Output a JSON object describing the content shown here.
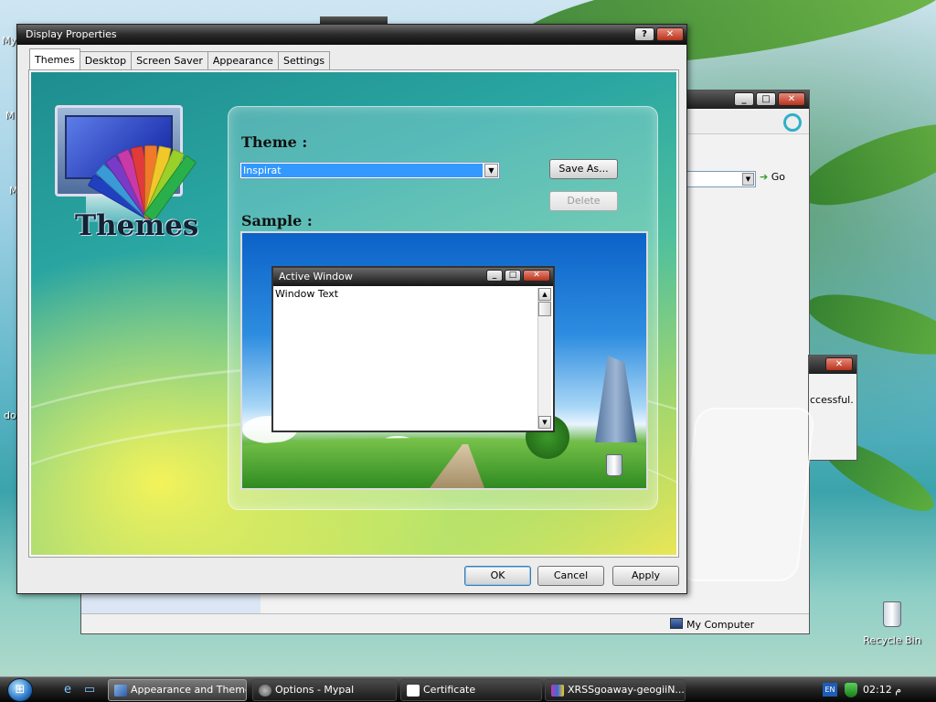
{
  "desktop": {
    "labels": [
      "My",
      "M",
      "M",
      "do"
    ],
    "recycle_bin": "Recycle Bin"
  },
  "explorer_window": {
    "go_label": "Go",
    "status_text": "My Computer"
  },
  "message_window": {
    "text": "ccessful."
  },
  "dialog": {
    "title": "Display Properties",
    "help_label": "?",
    "close_label": "✕",
    "tabs": [
      "Themes",
      "Desktop",
      "Screen Saver",
      "Appearance",
      "Settings"
    ],
    "active_tab": "Themes",
    "hero_title": "Themes",
    "theme_label": "Theme :",
    "theme_value": "Inspirat",
    "save_as_label": "Save As...",
    "delete_label": "Delete",
    "sample_label": "Sample :",
    "sample_window": {
      "title": "Active Window",
      "body_text": "Window Text"
    },
    "ok_label": "OK",
    "cancel_label": "Cancel",
    "apply_label": "Apply"
  },
  "taskbar": {
    "tasks": [
      "Appearance and Themes",
      "Options - Mypal",
      "Certificate",
      "XRSSgoaway-geogiiN..."
    ],
    "language": "EN",
    "clock": "02:12 م"
  },
  "colors": {
    "selection": "#3399ff",
    "titlebar_dark": "#1e1e1e"
  }
}
